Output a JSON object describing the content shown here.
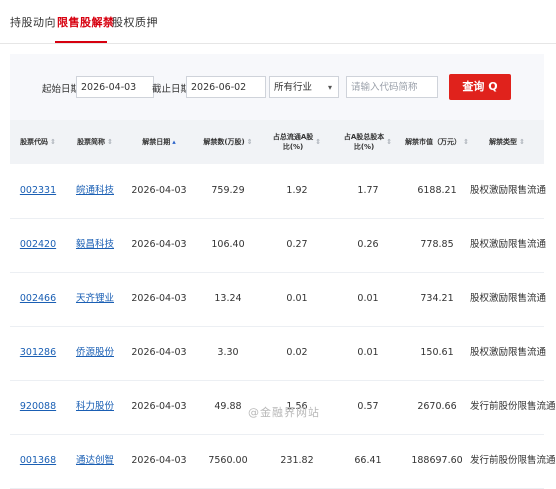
{
  "tabs": [
    {
      "label": "持股动向"
    },
    {
      "label": "限售股解禁"
    },
    {
      "label": "股权质押"
    }
  ],
  "filters": {
    "start_label": "起始日期：",
    "start_value": "2026-04-03",
    "end_label": "截止日期：",
    "end_value": "2026-06-02",
    "industry_value": "所有行业",
    "search_placeholder": "请输入代码简称",
    "query_label": "查询 Q"
  },
  "table": {
    "columns": [
      "股票代码",
      "股票简称",
      "解禁日期",
      "解禁数(万股)",
      "占总流通A股\n比(%)",
      "占A股总股本\n比(%)",
      "解禁市值（万元）",
      "解禁类型"
    ],
    "rows": [
      [
        "002331",
        "皖通科技",
        "2026-04-03",
        "759.29",
        "1.92",
        "1.77",
        "6188.21",
        "股权激励限售流通"
      ],
      [
        "002420",
        "毅昌科技",
        "2026-04-03",
        "106.40",
        "0.27",
        "0.26",
        "778.85",
        "股权激励限售流通"
      ],
      [
        "002466",
        "天齐锂业",
        "2026-04-03",
        "13.24",
        "0.01",
        "0.01",
        "734.21",
        "股权激励限售流通"
      ],
      [
        "301286",
        "侨源股份",
        "2026-04-03",
        "3.30",
        "0.02",
        "0.01",
        "150.61",
        "股权激励限售流通"
      ],
      [
        "920088",
        "科力股份",
        "2026-04-03",
        "49.88",
        "1.56",
        "0.57",
        "2670.66",
        "发行前股份限售流通"
      ],
      [
        "001368",
        "通达创智",
        "2026-04-03",
        "7560.00",
        "231.82",
        "66.41",
        "188697.60",
        "发行前股份限售流通"
      ]
    ]
  },
  "watermark": "@金融界网站"
}
